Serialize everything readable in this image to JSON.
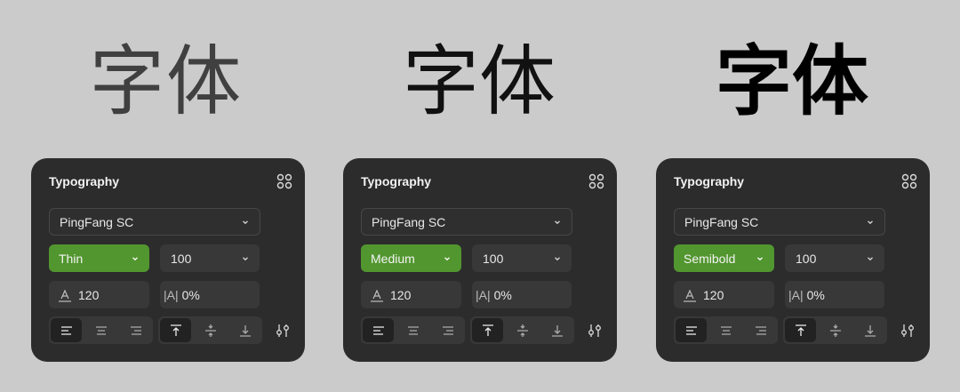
{
  "samples": [
    {
      "text": "字体",
      "weight": "Thin"
    },
    {
      "text": "字体",
      "weight": "Medium"
    },
    {
      "text": "字体",
      "weight": "Semibold"
    }
  ],
  "panels": [
    {
      "title": "Typography",
      "font": "PingFang SC",
      "weight": "Thin",
      "size": "100",
      "line_height": "120",
      "letter_spacing_sep": "|A|",
      "letter_spacing": "0%"
    },
    {
      "title": "Typography",
      "font": "PingFang SC",
      "weight": "Medium",
      "size": "100",
      "line_height": "120",
      "letter_spacing_sep": "|A|",
      "letter_spacing": "0%"
    },
    {
      "title": "Typography",
      "font": "PingFang SC",
      "weight": "Semibold",
      "size": "100",
      "line_height": "120",
      "letter_spacing_sep": "|A|",
      "letter_spacing": "0%"
    }
  ],
  "icons": {
    "panel_menu": "grid-dots-icon",
    "dropdown": "chevron-down-icon",
    "line_height": "line-height-icon",
    "align": [
      "align-left-icon",
      "align-center-icon",
      "align-right-icon"
    ],
    "vertical_align": [
      "align-top-icon",
      "align-middle-icon",
      "align-bottom-icon"
    ],
    "advanced": "sliders-icon"
  },
  "colors": {
    "background": "#cbcbcb",
    "panel": "#2c2c2c",
    "field": "#383838",
    "accent": "#52962f",
    "text": "#e8e8e8"
  }
}
